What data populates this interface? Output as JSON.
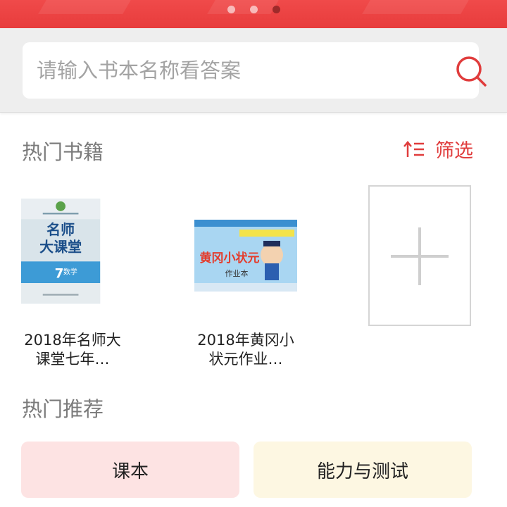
{
  "banner": {
    "dots": 3,
    "active_dot": 2
  },
  "search": {
    "placeholder": "请输入书本名称看答案",
    "icon": "search-icon",
    "accent": "#e03c3c"
  },
  "hot_books": {
    "title": "热门书籍",
    "filter_label": "筛选",
    "filter_icon": "sort-icon",
    "books": [
      {
        "title": "2018年名师大课堂七年…",
        "cover": {
          "brand": "名师大课堂",
          "grade": "7",
          "subject": "数学"
        }
      },
      {
        "title": "2018年黄冈小状元作业…",
        "cover": {
          "brand": "黄冈小状元作业本"
        }
      }
    ],
    "add_icon": "plus-icon"
  },
  "recommend": {
    "title": "热门推荐",
    "categories": [
      {
        "label": "课本",
        "color": "#fde3e3"
      },
      {
        "label": "能力与测试",
        "color": "#fdf7e2"
      }
    ]
  }
}
